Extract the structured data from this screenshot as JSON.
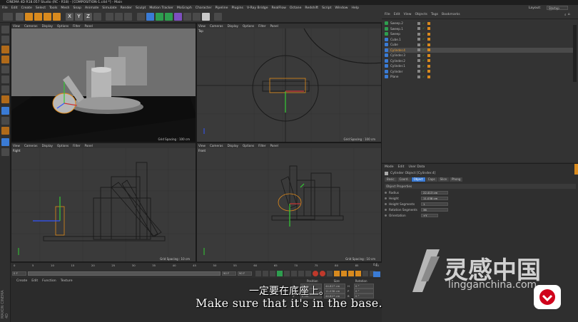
{
  "app": {
    "title": "CINEMA 4D R18.057 Studio (RC - R18) - [COMPOSITION-1.c4d *] - Main",
    "layout_label": "Layout:",
    "layout_value": "Startup (User)"
  },
  "menu": [
    "File",
    "Edit",
    "Create",
    "Select",
    "Tools",
    "Mesh",
    "Snap",
    "Animate",
    "Simulate",
    "Render",
    "Sculpt",
    "Motion Tracker",
    "MoGraph",
    "Character",
    "Pipeline",
    "Plugins",
    "V-Ray Bridge",
    "RealFlow",
    "Octane",
    "Redshift",
    "Script",
    "Window",
    "Help"
  ],
  "toolbar": {
    "axis_labels": [
      "X",
      "Y",
      "Z"
    ]
  },
  "viewports": {
    "menu": [
      "View",
      "Cameras",
      "Display",
      "Options",
      "Filter",
      "Panel"
    ],
    "perspective": {
      "label": "Perspective",
      "grid": "Grid Spacing : 100 cm"
    },
    "top": {
      "label": "Top",
      "grid": "Grid Spacing : 100 cm"
    },
    "right": {
      "label": "Right",
      "grid": "Grid Spacing : 10 cm"
    },
    "front": {
      "label": "Front",
      "grid": "Grid Spacing : 10 cm"
    }
  },
  "timeline": {
    "ticks": [
      "0",
      "5",
      "10",
      "15",
      "20",
      "25",
      "30",
      "35",
      "40",
      "45",
      "50",
      "55",
      "60",
      "65",
      "70",
      "75",
      "80",
      "85",
      "90"
    ],
    "current_frame": "0 F",
    "start_frame": "0 F",
    "end_frame": "90 F",
    "end_field": "90 F",
    "frame_readout": "0 F"
  },
  "materials": {
    "menu": [
      "Create",
      "Edit",
      "Function",
      "Texture"
    ]
  },
  "coords": {
    "headers": [
      "Position",
      "Size",
      "Rotation"
    ],
    "rows": [
      {
        "axis": "X",
        "pos": "0 cm",
        "size": "44.827 cm",
        "rot": "H",
        "rotval": "0 °"
      },
      {
        "axis": "Y",
        "pos": "0 cm",
        "size": "11.038 cm",
        "rot": "P",
        "rotval": "0 °"
      },
      {
        "axis": "Z",
        "pos": "0 cm",
        "size": "44.827 cm",
        "rot": "B",
        "rotval": "0 °"
      }
    ]
  },
  "objects": {
    "menu": [
      "File",
      "Edit",
      "View",
      "Objects",
      "Tags",
      "Bookmarks"
    ],
    "items": [
      "Sweep.2",
      "Sweep.1",
      "Sweep",
      "Cube.1",
      "Cube",
      "Cylinder.4",
      "Cylinder.3",
      "Cylinder.2",
      "Cylinder.1",
      "Cylinder",
      "Plane"
    ]
  },
  "attributes": {
    "menu": [
      "Mode",
      "Edit",
      "User Data"
    ],
    "title": "Cylinder Object [Cylinder.4]",
    "tabs": [
      "Basic",
      "Coord.",
      "Object",
      "Caps",
      "Slice",
      "Phong"
    ],
    "section": "Object Properties",
    "props": [
      {
        "label": "Radius",
        "value": "22.413 cm"
      },
      {
        "label": "Height",
        "value": "11.038 cm"
      },
      {
        "label": "Height Segments",
        "value": "1"
      },
      {
        "label": "Rotation Segments",
        "value": "36"
      },
      {
        "label": "Orientation",
        "value": "+Y"
      }
    ]
  },
  "branding": {
    "side_logo": "MAXON CINEMA 4D",
    "watermark_cn": "灵感中国",
    "watermark_url": "lingganchina.com"
  },
  "subtitles": {
    "cn": "一定要在底座上。",
    "en": "Make sure that it's in the base."
  }
}
